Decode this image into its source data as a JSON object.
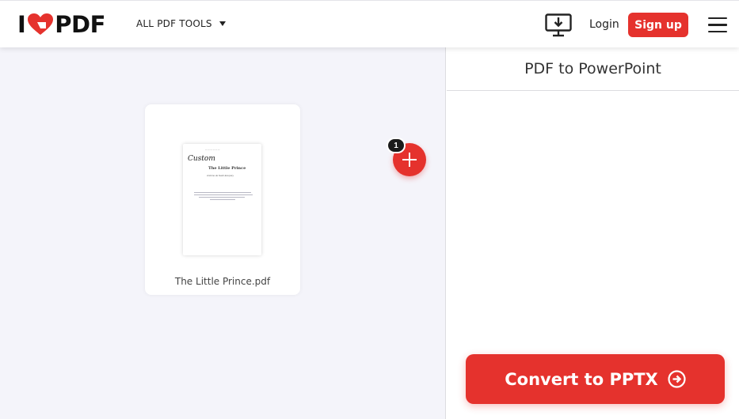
{
  "header": {
    "logo": {
      "prefix": "I",
      "suffix": "PDF"
    },
    "tools_menu_label": "ALL PDF TOOLS",
    "login_label": "Login",
    "signup_label": "Sign up"
  },
  "workspace": {
    "file": {
      "name": "The Little Prince.pdf",
      "thumbnail": {
        "script_title": "Custom",
        "title": "The Little Prince",
        "subtitle": "Antoine de Saint-Exupéry"
      }
    },
    "file_count": "1"
  },
  "panel": {
    "title": "PDF to PowerPoint",
    "convert_label": "Convert to PPTX"
  },
  "colors": {
    "brand_red": "#e5322d",
    "workspace_bg": "#f4f4fa"
  },
  "icons": {
    "logo": "heart-icon",
    "tools": "caret-down-icon",
    "desktop": "desktop-download-icon",
    "menu": "hamburger-icon",
    "add": "plus-icon",
    "convert": "arrow-right-circle-icon"
  }
}
